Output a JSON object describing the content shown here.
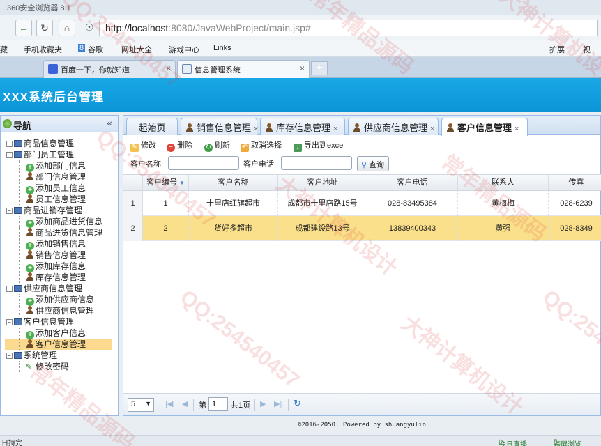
{
  "browser": {
    "title": "360安全浏览器 8.1",
    "url_host": "http://localhost",
    "url_rest": ":8080/JavaWebProject/main.jsp#",
    "favorites": [
      "藏",
      "手机收藏夹",
      "谷歌",
      "网址大全",
      "游戏中心",
      "Links"
    ],
    "fav_right": [
      "扩展",
      "视"
    ],
    "tabs": [
      {
        "label": "百度一下，你就知道",
        "close": "×"
      },
      {
        "label": "信息管理系统",
        "close": "×"
      }
    ],
    "new_tab": "+"
  },
  "app": {
    "title": "XXX系统后台管理"
  },
  "sidebar": {
    "title": "导航",
    "collapse": "«",
    "tree": [
      {
        "label": "商品信息管理",
        "kind": "group"
      },
      {
        "label": "部门员工管理",
        "kind": "group"
      },
      {
        "label": "添加部门信息",
        "kind": "add"
      },
      {
        "label": "部门信息管理",
        "kind": "user"
      },
      {
        "label": "添加员工信息",
        "kind": "add"
      },
      {
        "label": "员工信息管理",
        "kind": "user"
      },
      {
        "label": "商品进销存管理",
        "kind": "group"
      },
      {
        "label": "添加商品进货信息",
        "kind": "add"
      },
      {
        "label": "商品进货信息管理",
        "kind": "user"
      },
      {
        "label": "添加销售信息",
        "kind": "add"
      },
      {
        "label": "销售信息管理",
        "kind": "user"
      },
      {
        "label": "添加库存信息",
        "kind": "add"
      },
      {
        "label": "库存信息管理",
        "kind": "user"
      },
      {
        "label": "供应商信息管理",
        "kind": "group"
      },
      {
        "label": "添加供应商信息",
        "kind": "add"
      },
      {
        "label": "供应商信息管理",
        "kind": "user"
      },
      {
        "label": "客户信息管理",
        "kind": "group"
      },
      {
        "label": "添加客户信息",
        "kind": "add"
      },
      {
        "label": "客户信息管理",
        "kind": "user",
        "selected": true
      },
      {
        "label": "系统管理",
        "kind": "group"
      },
      {
        "label": "修改密码",
        "kind": "edit"
      }
    ]
  },
  "main": {
    "tabs": [
      {
        "label": "起始页",
        "icon": false
      },
      {
        "label": "销售信息管理",
        "icon": true,
        "close": "×"
      },
      {
        "label": "库存信息管理",
        "icon": true,
        "close": "×"
      },
      {
        "label": "供应商信息管理",
        "icon": true,
        "close": "×"
      },
      {
        "label": "客户信息管理",
        "icon": true,
        "close": "×",
        "active": true
      }
    ],
    "toolbar": {
      "edit": "修改",
      "delete": "删除",
      "refresh": "刷新",
      "deselect": "取消选择",
      "export": "导出到excel"
    },
    "search": {
      "name_label": "客户名称:",
      "name_value": "",
      "phone_label": "客户电话:",
      "phone_value": "",
      "button": "查询"
    },
    "grid": {
      "columns": [
        "客户编号",
        "客户名称",
        "客户地址",
        "客户电话",
        "联系人",
        "传真"
      ],
      "sort_indicator": "▼",
      "rows": [
        {
          "rownum": "1",
          "cells": [
            "1",
            "十里店红旗超市",
            "成都市十里店路15号",
            "028-83495384",
            "黄梅梅",
            "028-6239"
          ]
        },
        {
          "rownum": "2",
          "cells": [
            "2",
            "货好多超市",
            "成都建设路13号",
            "13839400343",
            "黄强",
            "028-8349"
          ],
          "highlighted": true
        }
      ]
    },
    "pager": {
      "page_size": "5",
      "page_prefix": "第",
      "page_value": "1",
      "page_suffix": "共1页",
      "first": "|◀",
      "prev": "◀",
      "next": "▶",
      "last": "▶|",
      "refresh": "↻"
    }
  },
  "footer": "©2016-2050. Powered by shuangyulin",
  "statusbar": {
    "left": "日持完",
    "live": "今日直播",
    "mode": "跨屏浏览"
  },
  "watermarks": [
    "QQ:254540457",
    "常年精品源码",
    "大神计算机设计",
    "QQ:254540457",
    "大神计算机设计",
    "常年精品源码",
    "QQ:254540457",
    "大神计算机设计",
    "QQ:254540457",
    "常年精品源码"
  ],
  "colors": {
    "header_blue": "#0b95d8",
    "selected_row": "#fbe08b",
    "panel_border": "#99bbe8"
  }
}
